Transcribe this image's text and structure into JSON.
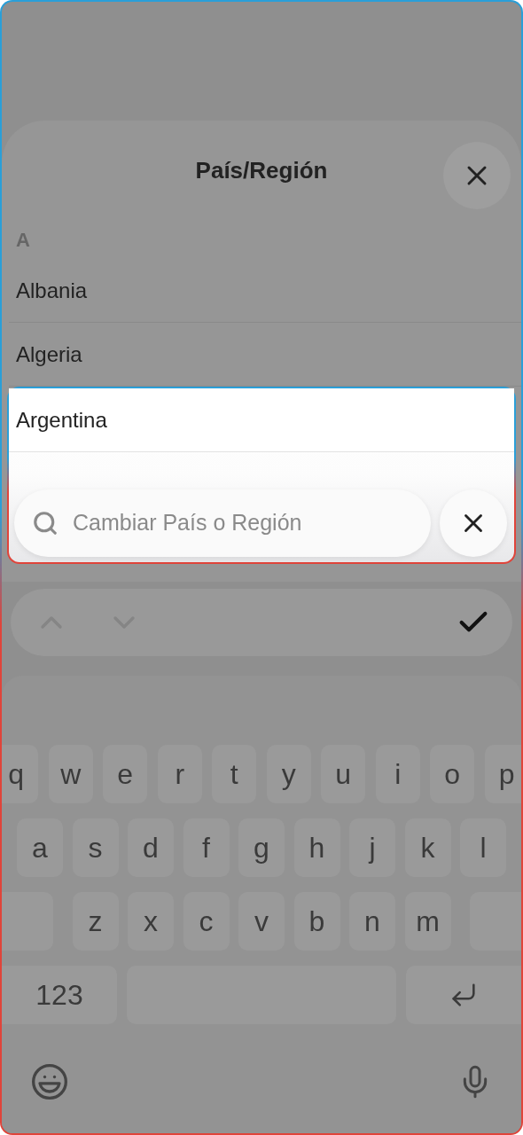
{
  "sheet": {
    "title": "País/Región",
    "sections": [
      {
        "header": "A",
        "items": [
          {
            "name": "Albania",
            "highlighted": false
          },
          {
            "name": "Algeria",
            "highlighted": false
          },
          {
            "name": "Argentina",
            "highlighted": true
          }
        ]
      }
    ]
  },
  "search": {
    "placeholder": "Cambiar País o Región"
  },
  "toolbar": {
    "previous": {
      "disabled": true
    },
    "next": {
      "disabled": true
    }
  },
  "keyboard": {
    "rows": [
      [
        "q",
        "w",
        "e",
        "r",
        "t",
        "y",
        "u",
        "i",
        "o",
        "p"
      ],
      [
        "a",
        "s",
        "d",
        "f",
        "g",
        "h",
        "j",
        "k",
        "l"
      ],
      [
        "z",
        "x",
        "c",
        "v",
        "b",
        "n",
        "m"
      ]
    ],
    "numbers_key": "123"
  }
}
